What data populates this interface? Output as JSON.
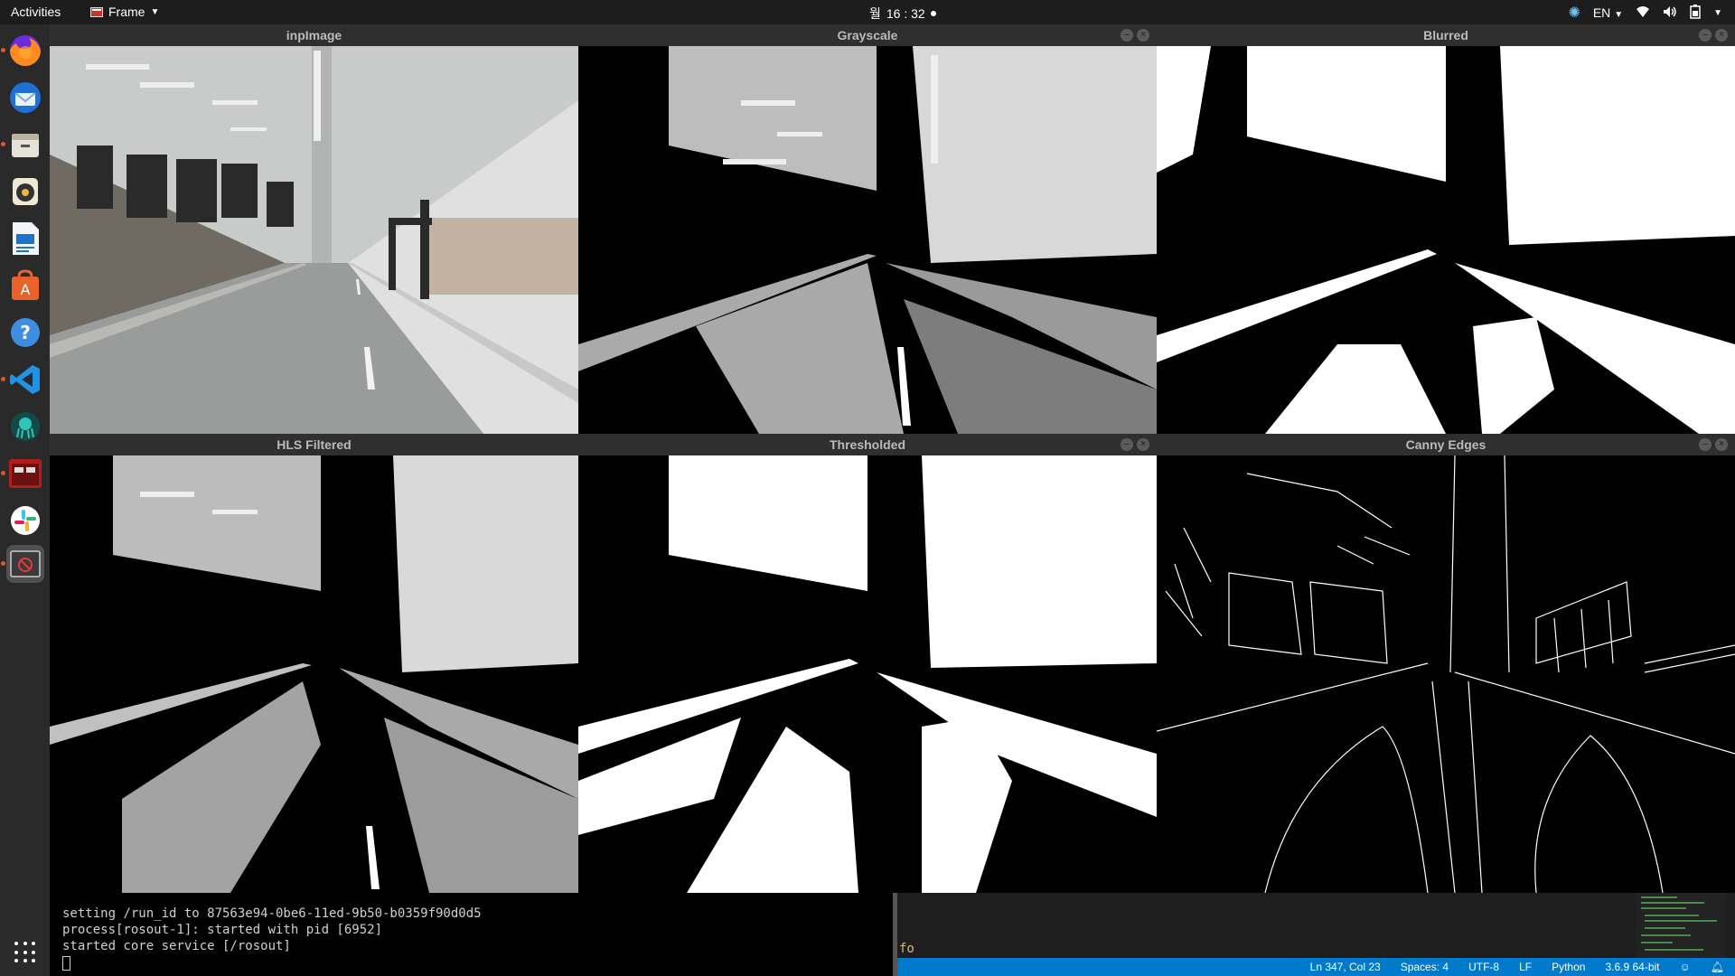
{
  "topbar": {
    "activities": "Activities",
    "app_menu": "Frame",
    "day": "월",
    "time": "16 : 32",
    "language": "EN"
  },
  "dock": {
    "apps": [
      "firefox-icon",
      "thunderbird-icon",
      "files-icon",
      "rhythmbox-icon",
      "libreoffice-writer-icon",
      "software-center-icon",
      "help-icon",
      "vscode-icon",
      "gitkraken-icon",
      "terminal-app-icon",
      "slack-icon",
      "frame-app-icon"
    ]
  },
  "windows": {
    "inp": {
      "title": "inpImage"
    },
    "gray": {
      "title": "Grayscale"
    },
    "blur": {
      "title": "Blurred"
    },
    "hls": {
      "title": "HLS Filtered"
    },
    "thresh": {
      "title": "Thresholded"
    },
    "canny": {
      "title": "Canny Edges"
    }
  },
  "terminal": {
    "lines": [
      "setting /run_id to 87563e94-0be6-11ed-9b50-b0359f90d0d5",
      "process[rosout-1]: started with pid [6952]",
      "started core service [/rosout]"
    ]
  },
  "vscode": {
    "code_fragment": "fo",
    "status": {
      "position": "Ln 347, Col 23",
      "spaces": "Spaces: 4",
      "encoding": "UTF-8",
      "eol": "LF",
      "language": "Python",
      "interpreter": "3.6.9 64-bit"
    }
  }
}
